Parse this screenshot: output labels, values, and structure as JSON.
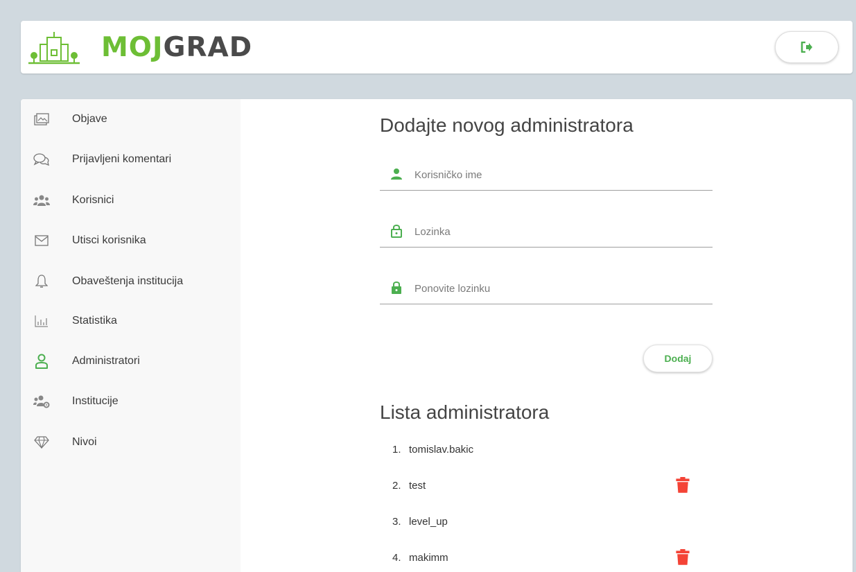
{
  "header": {
    "logo_part1": "MOJ",
    "logo_part2": "GRAD",
    "logout_icon": "sign-out-icon"
  },
  "colors": {
    "accent_green": "#6dbe35",
    "icon_green": "#4caf50",
    "delete_red": "#f44336",
    "background": "#d0d9df"
  },
  "sidebar": {
    "items": [
      {
        "label": "Objave",
        "icon": "images-icon"
      },
      {
        "label": "Prijavljeni komentari",
        "icon": "comments-icon"
      },
      {
        "label": "Korisnici",
        "icon": "users-icon"
      },
      {
        "label": "Utisci korisnika",
        "icon": "envelope-icon"
      },
      {
        "label": "Obaveštenja institucija",
        "icon": "bell-icon"
      },
      {
        "label": "Statistika",
        "icon": "bar-chart-icon"
      },
      {
        "label": "Administratori",
        "icon": "user-icon",
        "active": true
      },
      {
        "label": "Institucije",
        "icon": "users-cog-icon"
      },
      {
        "label": "Nivoi",
        "icon": "gem-icon"
      }
    ]
  },
  "form": {
    "title": "Dodajte novog administratora",
    "username_placeholder": "Korisničko ime",
    "password_placeholder": "Lozinka",
    "confirm_placeholder": "Ponovite lozinku",
    "submit_label": "Dodaj"
  },
  "admins": {
    "title": "Lista administratora",
    "items": [
      {
        "num": "1.",
        "name": "tomislav.bakic",
        "deletable": false
      },
      {
        "num": "2.",
        "name": "test",
        "deletable": true
      },
      {
        "num": "3.",
        "name": "level_up",
        "deletable": false
      },
      {
        "num": "4.",
        "name": "makimm",
        "deletable": true
      }
    ]
  }
}
